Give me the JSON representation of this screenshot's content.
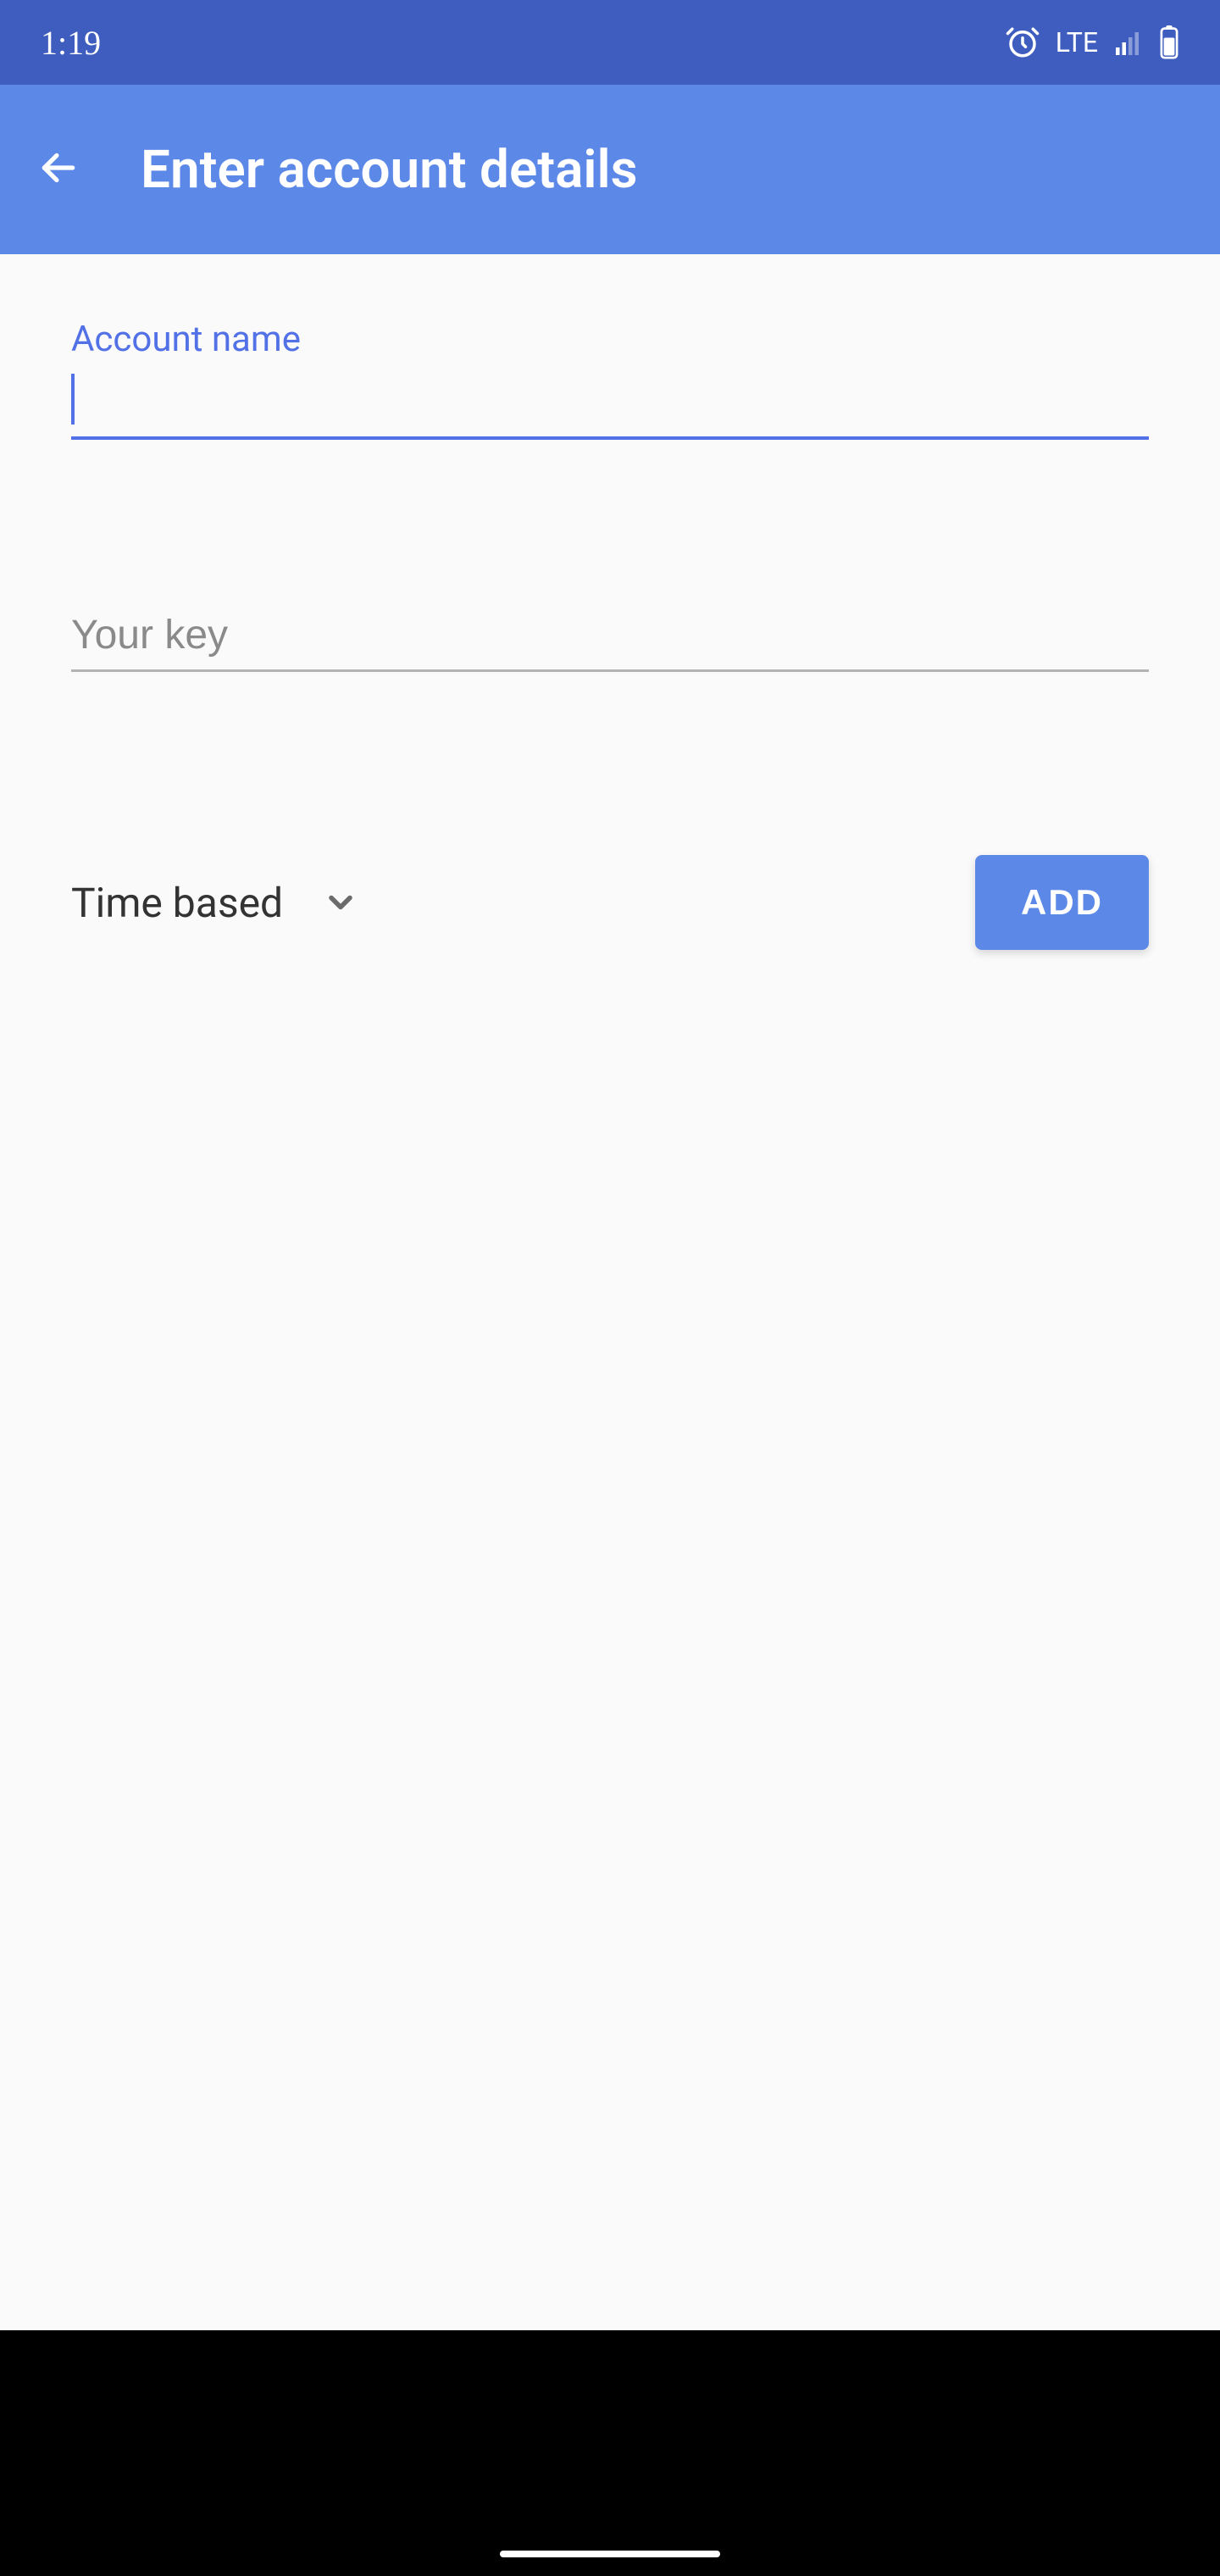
{
  "status": {
    "time": "1:19",
    "network": "LTE"
  },
  "app_bar": {
    "title": "Enter account details"
  },
  "fields": {
    "account_name": {
      "label": "Account name",
      "value": ""
    },
    "key": {
      "placeholder": "Your key",
      "value": ""
    }
  },
  "dropdown": {
    "selected": "Time based"
  },
  "buttons": {
    "add": "ADD"
  },
  "colors": {
    "accent": "#5c88e8",
    "accent_text": "#5271e6",
    "status_bar": "#3f5cbf",
    "background": "#fafafa"
  }
}
